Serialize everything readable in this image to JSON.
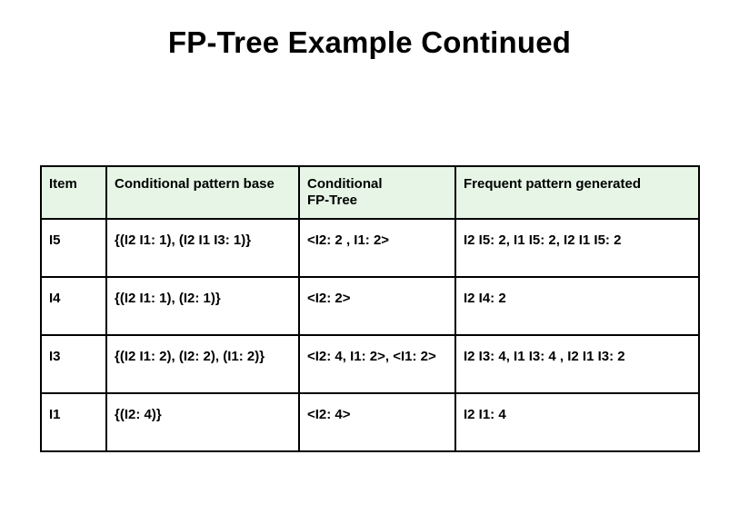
{
  "title": "FP-Tree Example Continued",
  "table": {
    "headers": [
      "Item",
      "Conditional pattern base",
      "Conditional\nFP-Tree",
      "Frequent pattern generated"
    ],
    "rows": [
      {
        "item": "I5",
        "cpb": "{(I2 I1: 1), (I2 I1 I3: 1)}",
        "cft": "<I2: 2 , I1: 2>",
        "fpg": "I2 I5: 2, I1 I5: 2, I2 I1 I5: 2"
      },
      {
        "item": "I4",
        "cpb": "{(I2 I1: 1), (I2: 1)}",
        "cft": "<I2: 2>",
        "fpg": "I2 I4: 2"
      },
      {
        "item": "I3",
        "cpb": "{(I2 I1: 2), (I2: 2), (I1: 2)}",
        "cft": "<I2: 4, I1: 2>, <I1: 2>",
        "fpg": "I2 I3: 4, I1 I3: 4 , I2 I1 I3: 2"
      },
      {
        "item": "I1",
        "cpb": "{(I2: 4)}",
        "cft": "<I2: 4>",
        "fpg": "I2 I1: 4"
      }
    ]
  }
}
